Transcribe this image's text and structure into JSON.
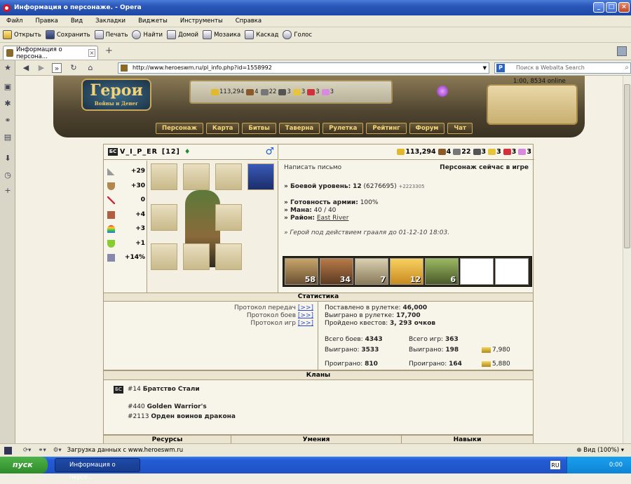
{
  "window": {
    "title": "Информация о персонаже. - Opera"
  },
  "menu": [
    "Файл",
    "Правка",
    "Вид",
    "Закладки",
    "Виджеты",
    "Инструменты",
    "Справка"
  ],
  "toolbar": [
    "Открыть",
    "Сохранить",
    "Печать",
    "Найти",
    "Домой",
    "Мозаика",
    "Каскад",
    "Голос"
  ],
  "tab": {
    "title": "Информация о персона..."
  },
  "address": {
    "url": "http://www.heroeswm.ru/pl_info.php?id=1558992",
    "search_placeholder": "Поиск в Webalta Search"
  },
  "game": {
    "logo": "Герои",
    "logo_sub": "Войны и Денег",
    "resources": [
      "113,294",
      "4",
      "22",
      "3",
      "3",
      "3",
      "3"
    ],
    "online": "1:00, 8534 online",
    "nav": [
      "Персонаж",
      "Карта",
      "Битвы",
      "Таверна",
      "Рулетка",
      "Рейтинг",
      "Форум",
      "Чат"
    ]
  },
  "character": {
    "name": "V_I_P_ER",
    "level": "[12]",
    "clan_tag": "БС",
    "gender_symbol": "♂",
    "resources": [
      "113,294",
      "4",
      "22",
      "3",
      "3",
      "3",
      "3"
    ],
    "stats": [
      "+29",
      "+30",
      "0",
      "+4",
      "+3",
      "+1",
      "+14%"
    ],
    "write_letter": "Написать письмо",
    "status": "Персонаж сейчас в игре",
    "combat_level_label": "» Боевой уровень:",
    "combat_level": "12",
    "combat_exp": "(6276695)",
    "combat_exp_plus": "+2223305",
    "army_ready_label": "» Готовность армии:",
    "army_ready": "100%",
    "mana_label": "» Мана:",
    "mana": "40 / 40",
    "district_label": "» Район:",
    "district": "East River",
    "grail_note": "» Герой под действием грааля до 01-12-10 18:03.",
    "army": [
      "58",
      "34",
      "7",
      "12",
      "6"
    ]
  },
  "statistics": {
    "header": "Статистика",
    "protocol_transfers": "Протокол передач",
    "protocol_battles": "Протокол боев",
    "protocol_games": "Протокол игр",
    "link": "[>>]",
    "bet_label": "Поставлено в рулетке:",
    "bet_value": "46,000",
    "won_label": "Выиграно в рулетке:",
    "won_value": "17,700",
    "quests_label": "Пройдено квестов:",
    "quests_value": "3, 293 очков",
    "battles_total_label": "Всего боев:",
    "battles_total": "4343",
    "battles_won_label": "Выиграно:",
    "battles_won": "3533",
    "battles_lost_label": "Проиграно:",
    "battles_lost": "810",
    "games_total_label": "Всего игр:",
    "games_total": "363",
    "games_won_label": "Выиграно:",
    "games_won": "198",
    "games_lost_label": "Проиграно:",
    "games_lost": "164",
    "gold_won": "7,980",
    "gold_lost": "5,880"
  },
  "clans": {
    "header": "Кланы",
    "list": [
      {
        "tag": "БС",
        "id": "#14",
        "name": "Братство Стали"
      },
      {
        "id": "#440",
        "name": "Golden Warrior's"
      },
      {
        "id": "#2113",
        "name": "Орден воинов дракона"
      }
    ]
  },
  "bottom_headers": [
    "Ресурсы",
    "Умения",
    "Навыки"
  ],
  "statusbar": {
    "text": "Загрузка данных с www.heroeswm.ru",
    "zoom": "Вид (100%)"
  },
  "taskbar": {
    "start": "пуск",
    "task": "Информация о персо...",
    "lang": "RU",
    "clock": "0:00"
  }
}
